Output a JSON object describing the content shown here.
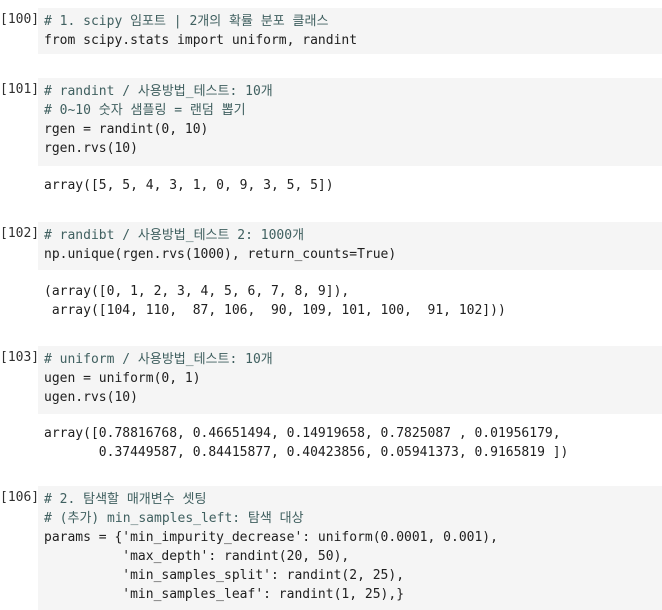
{
  "cells": [
    {
      "prompt": "[100]",
      "lines": [
        "# 1. scipy 임포트 | 2개의 확률 분포 클래스",
        "from scipy.stats import uniform, randint"
      ],
      "output": []
    },
    {
      "prompt": "[101]",
      "lines": [
        "# randint / 사용방법_테스트: 10개",
        "# 0~10 숫자 샘플링 = 랜덤 뽑기",
        "rgen = randint(0, 10)",
        "rgen.rvs(10)"
      ],
      "output": [
        "array([5, 5, 4, 3, 1, 0, 9, 3, 5, 5])"
      ]
    },
    {
      "prompt": "[102]",
      "lines": [
        "# randibt / 사용방법_테스트 2: 1000개",
        "np.unique(rgen.rvs(1000), return_counts=True)"
      ],
      "output": [
        "(array([0, 1, 2, 3, 4, 5, 6, 7, 8, 9]),",
        " array([104, 110,  87, 106,  90, 109, 101, 100,  91, 102]))"
      ]
    },
    {
      "prompt": "[103]",
      "lines": [
        "# uniform / 사용방법_테스트: 10개",
        "ugen = uniform(0, 1)",
        "ugen.rvs(10)"
      ],
      "output": [
        "array([0.78816768, 0.46651494, 0.14919658, 0.7825087 , 0.01956179,",
        "       0.37449587, 0.84415877, 0.40423856, 0.05941373, 0.9165819 ])"
      ]
    },
    {
      "prompt": "[106]",
      "lines": [
        "# 2. 탐색할 매개변수 셋팅",
        "# (추가) min_samples_left: 탐색 대상",
        "params = {'min_impurity_decrease': uniform(0.0001, 0.001),",
        "          'max_depth': randint(20, 50),",
        "          'min_samples_split': randint(2, 25),",
        "          'min_samples_leaf': randint(1, 25),}"
      ],
      "output": []
    }
  ]
}
